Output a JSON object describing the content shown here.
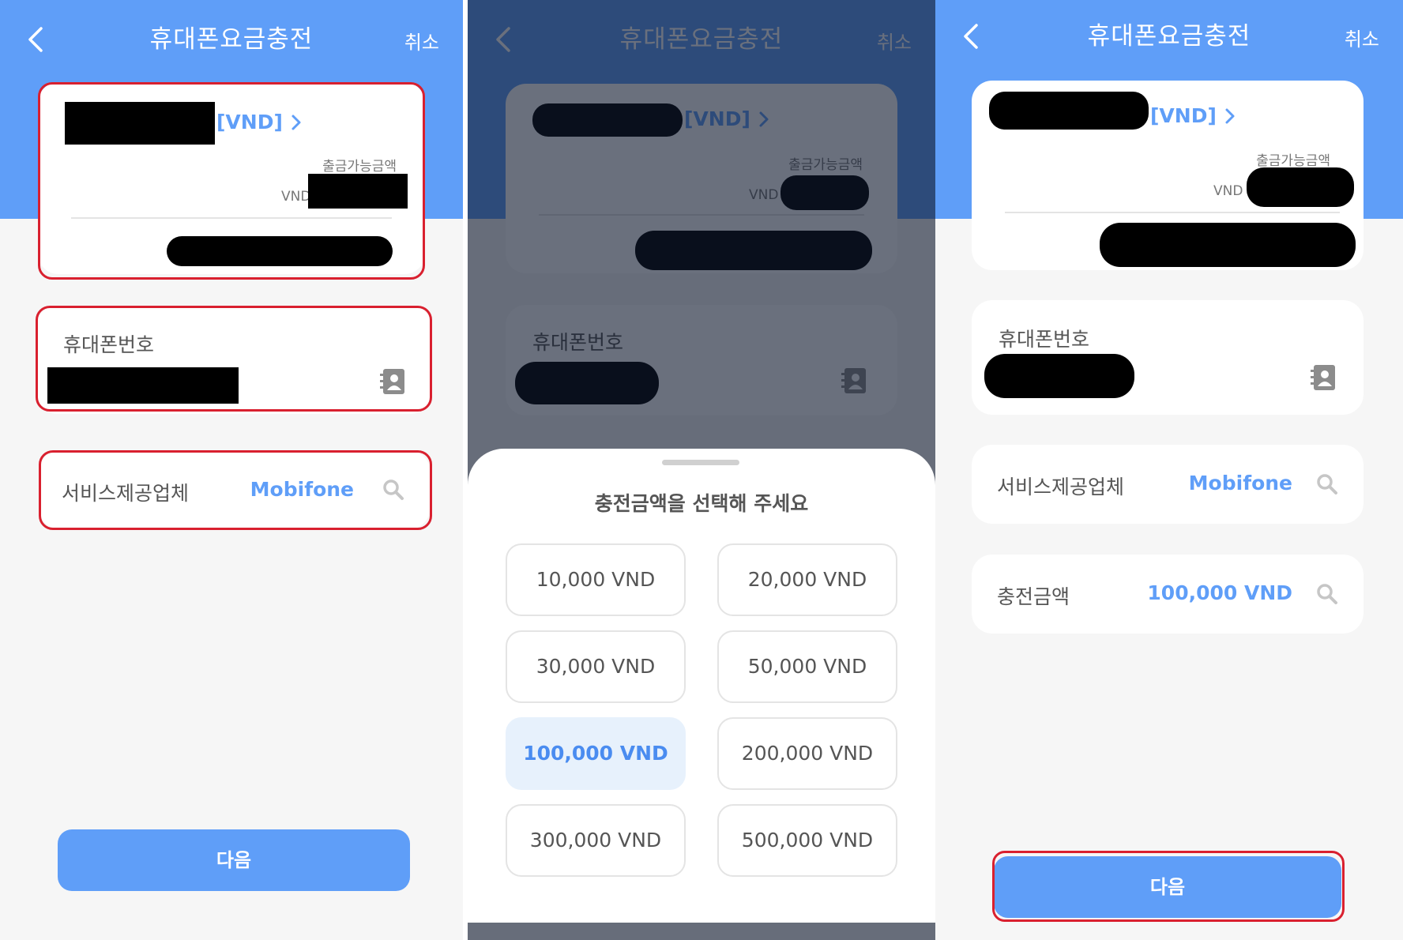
{
  "header": {
    "title": "휴대폰요금충전",
    "cancel_label": "취소"
  },
  "account": {
    "currency_tag": "[VND]",
    "available_label": "출금가능금액",
    "currency_prefix": "VND"
  },
  "phone": {
    "label": "휴대폰번호"
  },
  "provider": {
    "label": "서비스제공업체",
    "value": "Mobifone"
  },
  "charge": {
    "label": "충전금액",
    "value": "100,000 VND"
  },
  "next_label": "다음",
  "sheet": {
    "title": "충전금액을 선택해 주세요",
    "options": [
      "10,000 VND",
      "20,000 VND",
      "30,000 VND",
      "50,000 VND",
      "100,000 VND",
      "200,000 VND",
      "300,000 VND",
      "500,000 VND"
    ],
    "selected": "100,000 VND"
  },
  "colors": {
    "primary": "#5f9ef8",
    "highlight": "#d9202f",
    "selected_bg": "#e7f1fc"
  }
}
